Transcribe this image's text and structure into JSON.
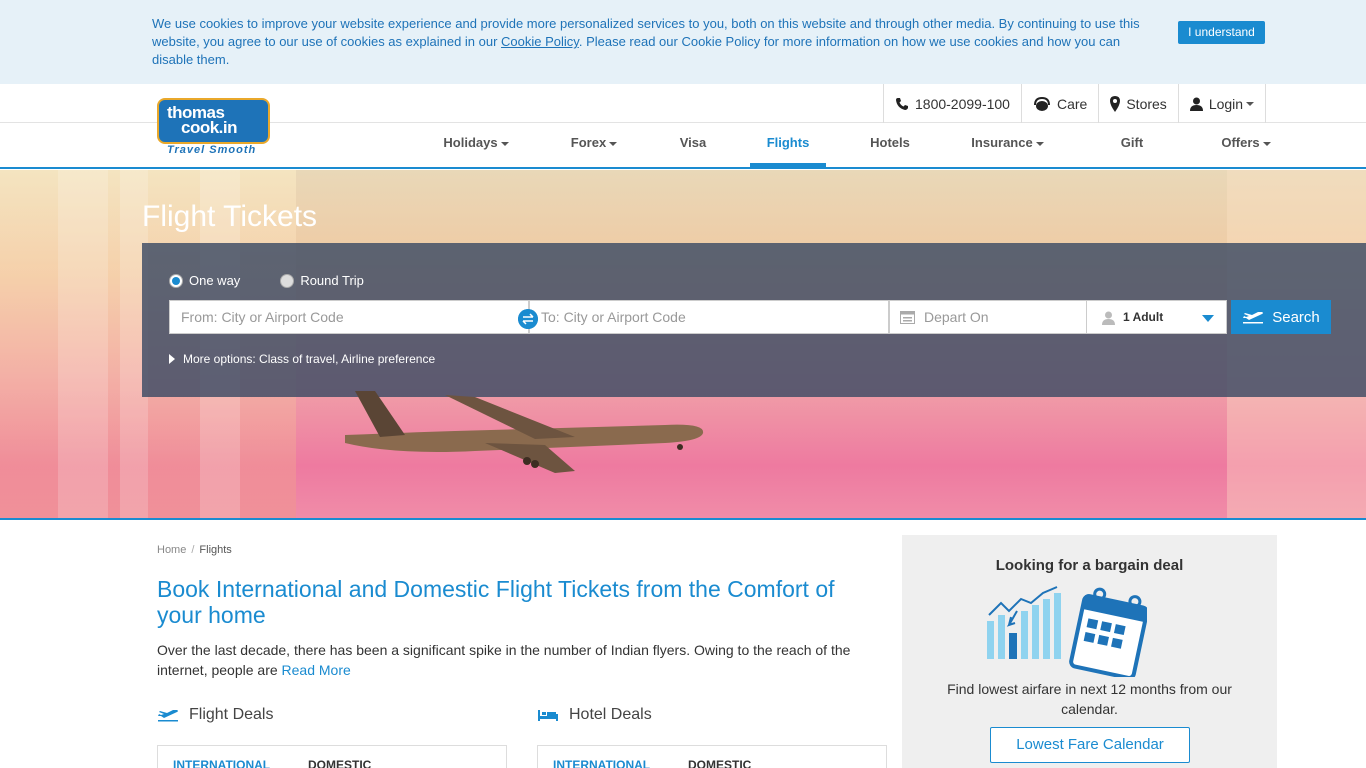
{
  "cookie": {
    "text_before": "We use cookies to improve your website experience and provide more personalized services to you, both on this website and through other media. By continuing to use this website, you agree to our use of cookies as explained in our ",
    "link": "Cookie Policy",
    "text_after": ". Please read our Cookie Policy for more information on how we use cookies and how you can disable them.",
    "button": "I understand"
  },
  "logo": {
    "line1": "thomas",
    "line2": "cook.in",
    "tagline": "Travel Smooth"
  },
  "topbar": {
    "phone": "1800-2099-100",
    "care": "Care",
    "stores": "Stores",
    "login": "Login"
  },
  "nav": [
    {
      "label": "Holidays"
    },
    {
      "label": "Forex"
    },
    {
      "label": "Visa"
    },
    {
      "label": "Flights"
    },
    {
      "label": "Hotels"
    },
    {
      "label": "Insurance"
    },
    {
      "label": "Gift Card"
    },
    {
      "label": "Offers"
    }
  ],
  "hero": {
    "title": "Flight Tickets",
    "one_way": "One way",
    "round_trip": "Round Trip",
    "from_placeholder": "From: City or Airport Code",
    "to_placeholder": "To: City or Airport Code",
    "depart_placeholder": "Depart On",
    "pax": "1 Adult",
    "search": "Search",
    "more_options": "More options: Class of travel, Airline preference"
  },
  "breadcrumb": {
    "home": "Home",
    "sep": "/",
    "current": "Flights"
  },
  "main": {
    "title": "Book International and Domestic Flight Tickets from the Comfort of your home",
    "desc": "Over the last decade, there has been a significant spike in the number of Indian flyers. Owing to the reach of the internet, people are ",
    "read_more": "Read More"
  },
  "deals": {
    "flight_title": "Flight Deals",
    "hotel_title": "Hotel Deals",
    "tab_international": "INTERNATIONAL",
    "tab_domestic": "DOMESTIC"
  },
  "side": {
    "title": "Looking for a bargain deal",
    "desc": "Find lowest airfare in next 12 months from our calendar.",
    "button": "Lowest Fare Calendar"
  },
  "colors": {
    "brand": "#1a8bd0",
    "banner_bg": "#e6f1f8",
    "panel": "#3c4b64"
  }
}
